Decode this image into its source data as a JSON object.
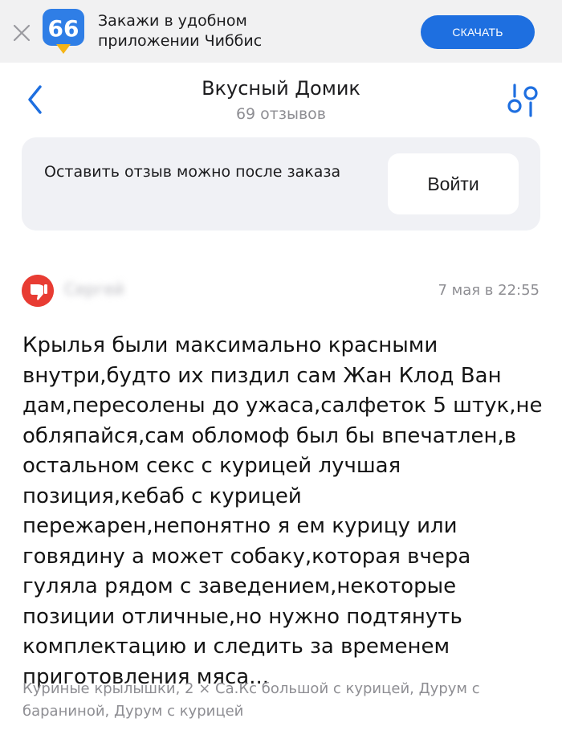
{
  "banner": {
    "logo_text": "66",
    "line1": "Закажи в удобном",
    "line2": "приложении Чиббис",
    "download_label": "СКАЧАТЬ"
  },
  "header": {
    "title": "Вкусный Домик",
    "subtitle": "69 отзывов",
    "back_icon": "chevron-left-icon",
    "filter_icon": "filter-sliders-icon"
  },
  "login_card": {
    "text": "Оставить отзыв можно после заказа",
    "button_label": "Войти"
  },
  "review": {
    "rating_icon": "thumbs-down-icon",
    "author": "Сергей",
    "date": "7 мая в 22:55",
    "text": "Крылья были максимально красными внутри,будто их пиздил сам Жан Клод Ван дам,пересолены до ужаса,салфеток 5 штук,не обляпайся,сам обломоф был бы впечатлен,в остальном секс с курицей лучшая позиция,кебаб с курицей пережарен,непонятно я ем курицу или говядину а может собаку,которая вчера гуляла рядом с заведением,некоторые позиции отличные,но нужно подтянуть комплектацию и следить за временем приготовления мяса...",
    "order_items": "Куриные крылышки, 2 × Са.Кс большой с курицей, Дурум с бараниной, Дурум с курицей"
  },
  "colors": {
    "accent": "#1e6fe0",
    "dislike": "#e83c33",
    "card_bg": "#f0f1f5",
    "banner_bg": "#f1f1f2",
    "muted_text": "#8e8e93"
  }
}
